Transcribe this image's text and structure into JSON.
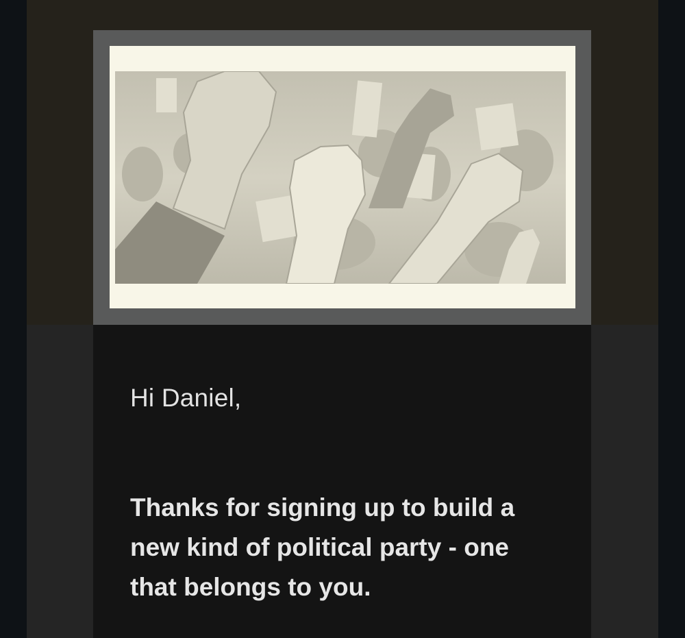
{
  "hero_image": {
    "icon": "raised-fists-protest-photo",
    "colors": {
      "mat": "#f8f6e8",
      "border": "#595a5a",
      "photo_tint": "#cfccbd"
    }
  },
  "email": {
    "greeting": "Hi Daniel,",
    "lead": "Thanks for signing up to build a new kind of political party - one that belongs to you."
  },
  "colors": {
    "page_background": "#0e1216",
    "frame": "#252525",
    "hero_band": "#25221b",
    "column": "#141414",
    "text": "#e6e6e6"
  }
}
